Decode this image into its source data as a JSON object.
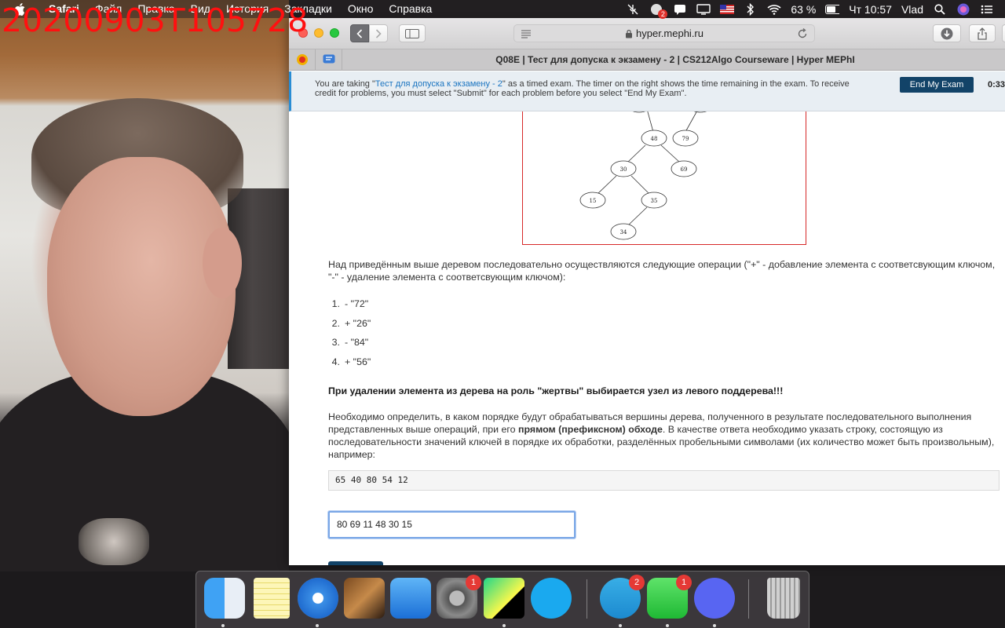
{
  "watermark": "20200903T105728",
  "menubar": {
    "app_name": "Safari",
    "menus": [
      "Файл",
      "Правка",
      "Вид",
      "История",
      "Закладки",
      "Окно",
      "Справка"
    ],
    "battery": "63 %",
    "clock": "Чт 10:57",
    "user": "Vlad",
    "notif_badge": "2"
  },
  "browser": {
    "url": "hyper.mephi.ru",
    "tab_title": "Q08E | Тест для допуска к экзамену - 2 | CS212Algo Courseware | Hyper MEPhI"
  },
  "banner": {
    "text_before": "You are taking \"",
    "exam_link": "Тест для допуска к экзамену - 2",
    "text_after": "\" as a timed exam. The timer on the right shows the time remaining in the exam. To receive credit for problems, you must select \"Submit\" for each problem before you select \"End My Exam\".",
    "end_button": "End My Exam",
    "timer": "0:33:"
  },
  "tree": {
    "nodes": [
      "48",
      "79",
      "30",
      "69",
      "15",
      "35",
      "34"
    ]
  },
  "problem": {
    "intro": "Над приведённым выше деревом последовательно осуществляются следующие операции (\"+\" - добавление элемента с соответсвующим ключом, \"-\" - удаление элемента с соответсвующим ключом):",
    "operations": [
      {
        "num": "1.",
        "op": "- \"72\""
      },
      {
        "num": "2.",
        "op": "+ \"26\""
      },
      {
        "num": "3.",
        "op": "- \"84\""
      },
      {
        "num": "4.",
        "op": "+ \"56\""
      }
    ],
    "warning": "При удалении элемента из дерева на роль \"жертвы\" выбирается узел из левого поддерева!!!",
    "task_part1": "Необходимо определить, в каком порядке будут обрабатываться вершины дерева, полученного в результате последовательного выполнения представленных выше операций, при его ",
    "task_bold": "прямом (префиксном) обходе",
    "task_part2": ". В качестве ответа необходимо указать строку, состоящую из последовательности значений ключей в порядке их обработки, разделённых пробельными символами (их количество может быть произвольным), например:",
    "example": "65 40 80 54 12",
    "answer_value": "80 69 11 48 30 15"
  },
  "dock": {
    "system_prefs_badge": "1",
    "telegram_badge": "2",
    "facetime_badge": "1"
  }
}
